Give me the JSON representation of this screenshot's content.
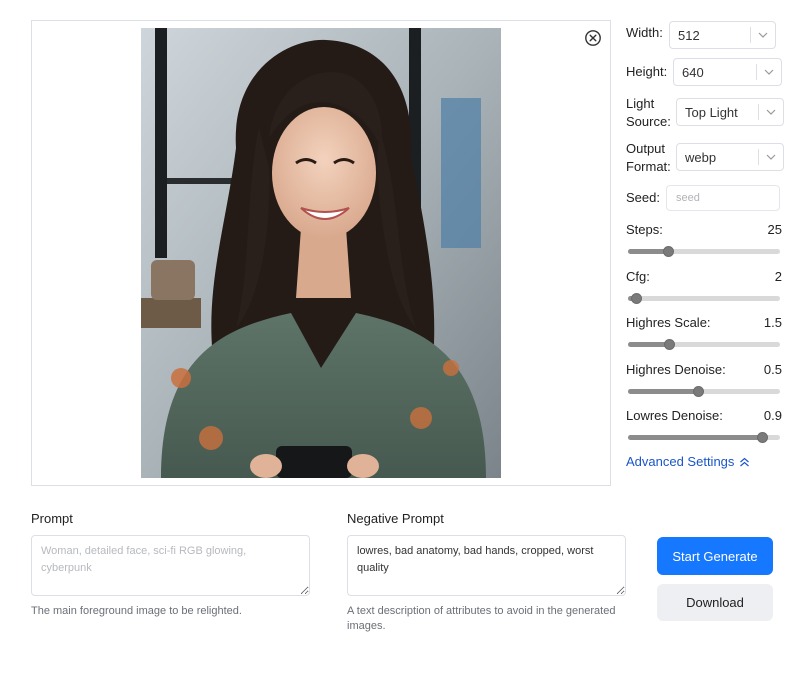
{
  "preview": {
    "close_icon": "circle-x-icon",
    "image_alt": "generated portrait"
  },
  "settings": {
    "width": {
      "label": "Width:",
      "value": "512"
    },
    "height": {
      "label": "Height:",
      "value": "640"
    },
    "light_source": {
      "label_line1": "Light",
      "label_line2": "Source:",
      "value": "Top Light"
    },
    "output_format": {
      "label_line1": "Output",
      "label_line2": "Format:",
      "value": "webp"
    },
    "seed": {
      "label": "Seed:",
      "placeholder": "seed",
      "value": ""
    },
    "sliders": [
      {
        "label": "Steps:",
        "value": "25",
        "fraction": 0.26
      },
      {
        "label": "Cfg:",
        "value": "2",
        "fraction": 0.05
      },
      {
        "label": "Highres Scale:",
        "value": "1.5",
        "fraction": 0.27
      },
      {
        "label": "Highres Denoise:",
        "value": "0.5",
        "fraction": 0.46
      },
      {
        "label": "Lowres Denoise:",
        "value": "0.9",
        "fraction": 0.88
      }
    ],
    "advanced_link": "Advanced Settings",
    "advanced_icon": "double-chevron-up-icon"
  },
  "prompt": {
    "title": "Prompt",
    "placeholder": "Woman, detailed face, sci-fi RGB glowing, cyberpunk",
    "value": "",
    "help": "The main foreground image to be relighted."
  },
  "negative_prompt": {
    "title": "Negative Prompt",
    "value": "lowres, bad anatomy, bad hands, cropped, worst quality",
    "help": "A text description of attributes to avoid in the generated images."
  },
  "actions": {
    "generate_label": "Start Generate",
    "download_label": "Download"
  },
  "colors": {
    "primary": "#1677ff",
    "link": "#1a55c9",
    "slider_fill": "#8c8c8c"
  }
}
